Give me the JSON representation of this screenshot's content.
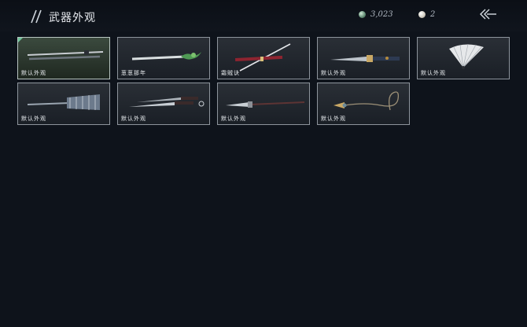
{
  "header": {
    "title": "武器外观",
    "currencies": [
      {
        "icon": "jade-coin-icon",
        "value": "3,023"
      },
      {
        "icon": "pearl-icon",
        "value": "2"
      }
    ]
  },
  "weapons": [
    {
      "label": "默认外观",
      "icon": "long-sword-icon",
      "selected": true
    },
    {
      "label": "葱葱那年",
      "icon": "green-flute-icon",
      "selected": false
    },
    {
      "label": "霜贼诀",
      "icon": "sword-with-red-scabbard-icon",
      "selected": false
    },
    {
      "label": "默认外观",
      "icon": "dagger-icon",
      "selected": false
    },
    {
      "label": "默认外观",
      "icon": "folding-fan-icon",
      "selected": false
    },
    {
      "label": "默认外观",
      "icon": "umbrella-spear-icon",
      "selected": false
    },
    {
      "label": "默认外观",
      "icon": "twin-blades-icon",
      "selected": false
    },
    {
      "label": "默认外观",
      "icon": "long-spear-icon",
      "selected": false
    },
    {
      "label": "默认外观",
      "icon": "rope-dart-icon",
      "selected": false
    }
  ],
  "colors": {
    "background": "#0e131b",
    "accent": "#6ec49a"
  }
}
